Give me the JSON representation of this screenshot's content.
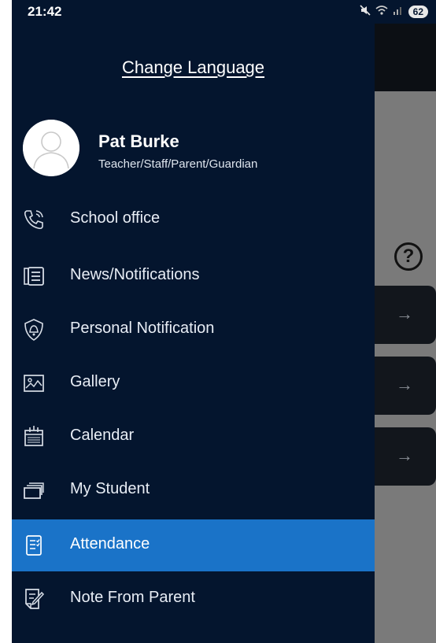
{
  "status_bar": {
    "time": "21:42",
    "mute_icon": "mute-icon",
    "wifi_icon": "wifi-icon",
    "signal_icon": "signal-icon",
    "battery": "62"
  },
  "drawer": {
    "change_language": "Change Language",
    "profile": {
      "name": "Pat Burke",
      "role": "Teacher/Staff/Parent/Guardian",
      "avatar_icon": "user-avatar-icon"
    },
    "items": [
      {
        "label": "School office",
        "icon": "phone-icon"
      },
      {
        "label": "News/Notifications",
        "icon": "news-icon"
      },
      {
        "label": "Personal Notification",
        "icon": "shield-bell-icon"
      },
      {
        "label": "Gallery",
        "icon": "image-icon"
      },
      {
        "label": "Calendar",
        "icon": "calendar-icon"
      },
      {
        "label": "My Student",
        "icon": "cards-icon"
      },
      {
        "label": "Attendance",
        "icon": "checklist-icon",
        "active": true
      },
      {
        "label": "Note From Parent",
        "icon": "note-edit-icon"
      }
    ]
  },
  "background": {
    "help_icon": "question-circle-icon",
    "card_arrow": "→",
    "cards": 3
  },
  "colors": {
    "drawer_bg": "#04152e",
    "active_item": "#1a73c8",
    "overlay": "#7a7a7a"
  }
}
